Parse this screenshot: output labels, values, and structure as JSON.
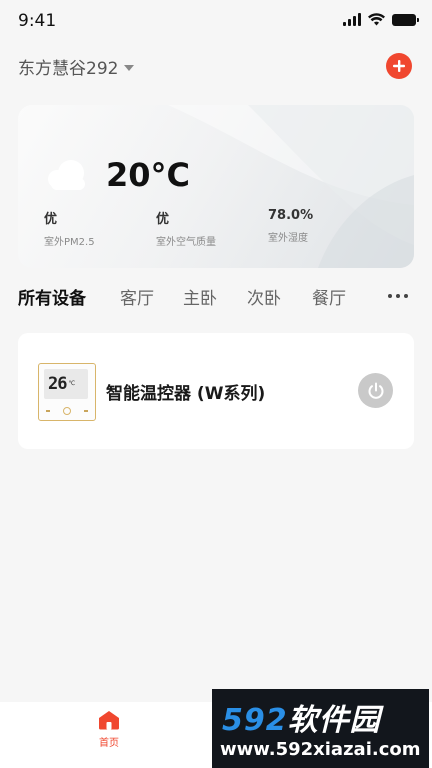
{
  "status_bar": {
    "time": "9:41"
  },
  "header": {
    "home_name": "东方慧谷292"
  },
  "weather": {
    "temperature": "20°C",
    "metrics": [
      {
        "value": "优",
        "label": "室外PM2.5"
      },
      {
        "value": "优",
        "label": "室外空气质量"
      },
      {
        "value": "78.0%",
        "label": "室外湿度"
      }
    ]
  },
  "tabs": [
    "所有设备",
    "客厅",
    "主卧",
    "次卧",
    "餐厅"
  ],
  "devices": [
    {
      "name": "智能温控器 (W系列)",
      "display_value": "26",
      "display_unit": "℃"
    }
  ],
  "bottom_nav": {
    "home_label": "首页"
  },
  "watermark": {
    "brand_number": "592",
    "brand_text": "软件园",
    "url": "www.592xiazai.com"
  },
  "colors": {
    "accent": "#f0472f",
    "power_off": "#c9c9c9",
    "watermark_blue": "#2a8fe6"
  }
}
